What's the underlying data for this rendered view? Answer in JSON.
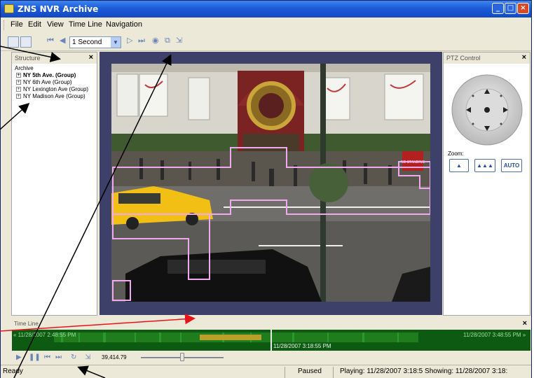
{
  "window": {
    "title": "ZNS NVR Archive",
    "min_label": "_",
    "max_label": "□",
    "close_label": "×"
  },
  "menu": {
    "items": [
      "File",
      "Edit",
      "View",
      "Time Line",
      "Navigation"
    ]
  },
  "toolbar": {
    "interval": "1 Second",
    "icons": [
      "layout-1-icon",
      "layout-2-icon",
      "step-back-icon",
      "back-icon",
      "forward-icon",
      "step-forward-icon",
      "record-icon",
      "snapshot-icon",
      "export-icon"
    ]
  },
  "structure_panel": {
    "header": "Structure",
    "close_label": "×",
    "root": "Archive",
    "items": [
      {
        "label": "NY 5th Ave. (Group)",
        "selected": true
      },
      {
        "label": "NY 6th Ave (Group)",
        "selected": false
      },
      {
        "label": "NY Lexington Ave (Group)",
        "selected": false
      },
      {
        "label": "NY Madison Ave (Group)",
        "selected": false
      }
    ]
  },
  "ptz_panel": {
    "header": "PTZ Control",
    "close_label": "×",
    "zoom_label": "Zoom:",
    "zoom_buttons": [
      "▲",
      "▲▲▲",
      "AUTO"
    ]
  },
  "video": {
    "sign_text": "NO STANDING"
  },
  "timeline": {
    "header": "Time Line",
    "close_label": "×",
    "start": "« 11/28/2007 2:48:55 PM",
    "current": "11/28/2007 3:18:55 PM",
    "end": "11/28/2007 3:48:55 PM »"
  },
  "playback": {
    "speed": "39,414.79",
    "slider_level": 0.5
  },
  "status": {
    "ready": "Ready",
    "state": "Paused",
    "playing": "Playing: 11/28/2007 3:18:5 Showing: 11/28/2007 3:18:"
  },
  "colors": {
    "title_bar": "#1c5bd8",
    "video_frame": "#3d4068",
    "timeline_green": "#0d5a12",
    "motion_zone": "#f0a8ee",
    "taxi": "#f2c015",
    "annotation_red": "#e8141a"
  }
}
